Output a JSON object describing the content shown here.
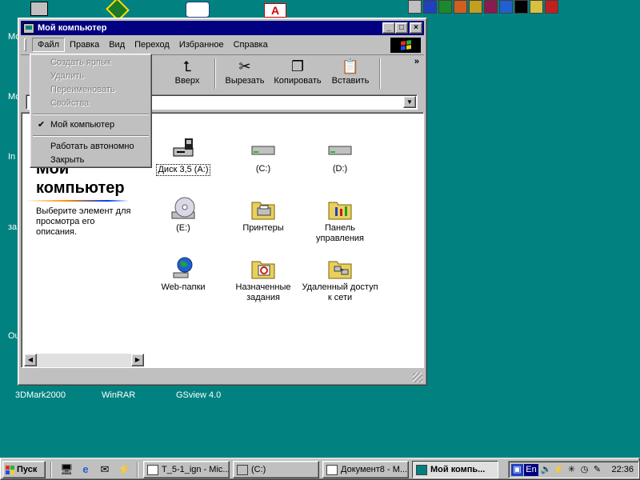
{
  "desktop": {
    "side_labels": [
      "Мо",
      "Мо",
      "In",
      "за",
      "Ou"
    ],
    "icon_labels": [
      "3DMark2000",
      "WinRAR",
      "GSview 4.0"
    ]
  },
  "window": {
    "title": "Мой компьютер",
    "menu": [
      "Файл",
      "Правка",
      "Вид",
      "Переход",
      "Избранное",
      "Справка"
    ],
    "toolbar": {
      "up": "Вверх",
      "cut": "Вырезать",
      "copy": "Копировать",
      "paste": "Вставить",
      "overflow": "»"
    },
    "left_pane": {
      "title": "Мой компьютер",
      "description": "Выберите элемент для просмотра его описания."
    },
    "items": [
      {
        "label": "Диск 3,5 (A:)",
        "icon": "floppy-drive-icon"
      },
      {
        "label": "(C:)",
        "icon": "hard-drive-icon"
      },
      {
        "label": "(D:)",
        "icon": "hard-drive-icon"
      },
      {
        "label": "(E:)",
        "icon": "cd-drive-icon"
      },
      {
        "label": "Принтеры",
        "icon": "printers-folder-icon"
      },
      {
        "label": "Панель управления",
        "icon": "control-panel-icon"
      },
      {
        "label": "Web-папки",
        "icon": "web-folders-icon"
      },
      {
        "label": "Назначенные задания",
        "icon": "scheduled-tasks-icon"
      },
      {
        "label": "Удаленный доступ к сети",
        "icon": "dialup-networking-icon"
      }
    ]
  },
  "file_menu": {
    "items": [
      {
        "label": "Создать ярлык",
        "disabled": true
      },
      {
        "label": "Удалить",
        "disabled": true
      },
      {
        "label": "Переименовать",
        "disabled": true
      },
      {
        "label": "Свойства",
        "disabled": true
      },
      {
        "label": "Мой компьютер",
        "checked": true
      },
      {
        "label": "Работать автономно"
      },
      {
        "label": "Закрыть"
      }
    ]
  },
  "taskbar": {
    "start_label": "Пуск",
    "tasks": [
      {
        "label": "T_5-1_ign - Mic...",
        "active": false
      },
      {
        "label": "(C:)",
        "active": false
      },
      {
        "label": "Документ8 - M...",
        "active": false
      },
      {
        "label": "Мой компь...",
        "active": true
      }
    ],
    "tray": {
      "lang": "En",
      "time": "22:36"
    }
  },
  "colors": {
    "desktop": "#018281",
    "titlebar": "#000080",
    "face": "#c0c0c0"
  }
}
